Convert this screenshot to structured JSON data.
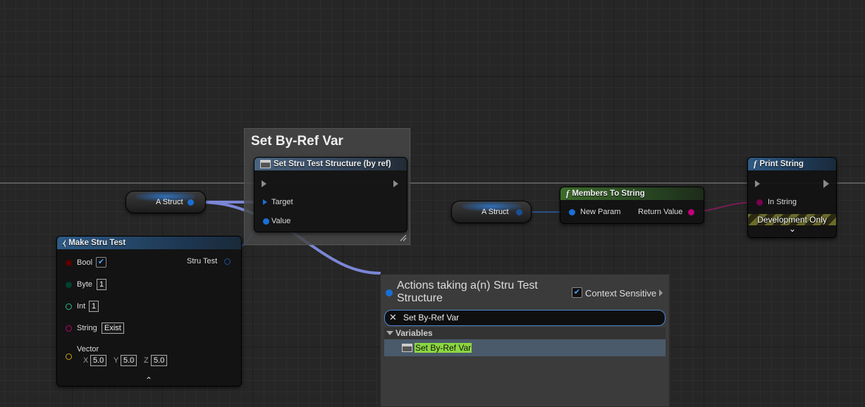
{
  "comment": {
    "title": "Set By-Ref Var"
  },
  "set_node": {
    "title": "Set Stru Test Structure (by ref)",
    "pins": [
      "Target",
      "Value"
    ]
  },
  "var_node_left": {
    "label": "A Struct"
  },
  "var_node_right": {
    "label": "A Struct"
  },
  "make_node": {
    "title": "Make Stru Test",
    "output": "Stru Test",
    "bool": {
      "label": "Bool",
      "checked": "✔"
    },
    "byte": {
      "label": "Byte",
      "value": "1"
    },
    "int": {
      "label": "Int",
      "value": "1"
    },
    "string": {
      "label": "String",
      "value": "Exist"
    },
    "vector": {
      "label": "Vector",
      "x_label": "X",
      "x": "5.0",
      "y_label": "Y",
      "y": "5.0",
      "z_label": "Z",
      "z": "5.0"
    },
    "collapse_glyph": "⌃"
  },
  "members_node": {
    "title": "Members To String",
    "func_glyph": "f",
    "input": "New Param",
    "output": "Return Value"
  },
  "print_node": {
    "title": "Print String",
    "func_glyph": "f",
    "input": "In String",
    "banner": "Development Only",
    "expand_glyph": "⌄"
  },
  "action_menu": {
    "title": "Actions taking a(n) Stru Test Structure",
    "context_label": "Context Sensitive",
    "context_checked": "✔",
    "search_value": "Set By-Ref Var",
    "clear_glyph": "✕",
    "category": "Variables",
    "item": "Set By-Ref Var"
  },
  "colors": {
    "struct_pin": "#1a6fd6",
    "string_pin": "#c2007a",
    "bool_pin": "#8a0000",
    "byte_pin": "#005c4a",
    "int_pin": "#2fb88c",
    "vector_pin": "#c8a11e",
    "highlight": "#8bd640"
  }
}
